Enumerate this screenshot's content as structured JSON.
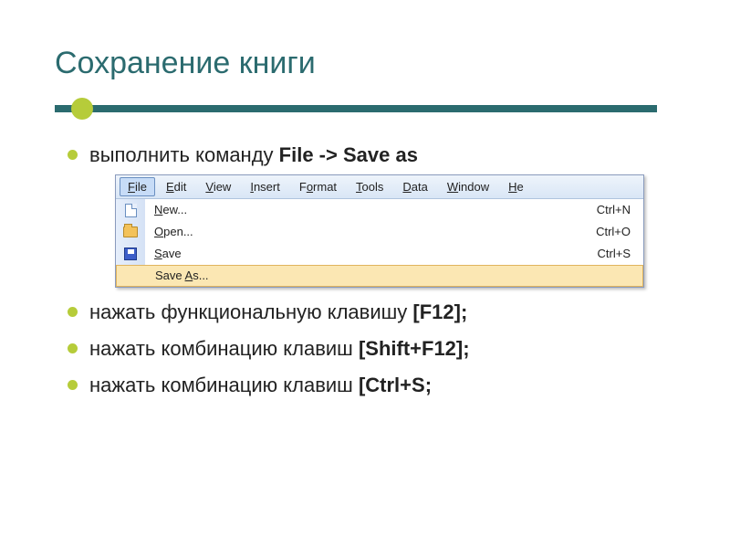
{
  "title": "Сохранение книги",
  "bullets": {
    "b1_pre": "выполнить команду ",
    "b1_bold": "File -> Save as",
    "b2_pre": "нажать функциональную клавишу ",
    "b2_bold": "[F12];",
    "b3_pre": "нажать комбинацию клавиш ",
    "b3_bold": "[Shift+F12];",
    "b4_pre": "нажать комбинацию клавиш ",
    "b4_bold": "[Ctrl+S;"
  },
  "menubar": {
    "file_u": "F",
    "file_r": "ile",
    "edit_u": "E",
    "edit_r": "dit",
    "view_u": "V",
    "view_r": "iew",
    "insert_u": "I",
    "insert_r": "nsert",
    "format_u": "F",
    "format_pre": "",
    "format_rest": "ormat",
    "format_mnem": "o",
    "tools_u": "T",
    "tools_r": "ools",
    "data_u": "D",
    "data_r": "ata",
    "window_u": "W",
    "window_r": "indow",
    "help_u": "H",
    "help_r": "e"
  },
  "menuitems": {
    "new_u": "N",
    "new_r": "ew...",
    "new_sc": "Ctrl+N",
    "open_u": "O",
    "open_r": "pen...",
    "open_sc": "Ctrl+O",
    "save_u": "S",
    "save_r": "ave",
    "save_sc": "Ctrl+S",
    "saveas_pre": "Save ",
    "saveas_u": "A",
    "saveas_r": "s...",
    "saveas_sc": ""
  }
}
